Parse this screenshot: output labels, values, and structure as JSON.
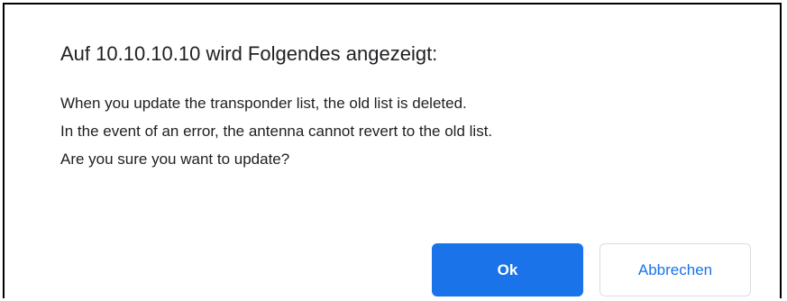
{
  "dialog": {
    "title": "Auf 10.10.10.10 wird Folgendes angezeigt:",
    "message_lines": [
      "When you update the transponder list, the old list is deleted.",
      "In the event of an error, the antenna cannot revert to the old list.",
      "Are you sure you want to update?"
    ],
    "ok_label": "Ok",
    "cancel_label": "Abbrechen"
  },
  "colors": {
    "accent": "#1a73e8",
    "text": "#202124",
    "border": "#000000"
  }
}
